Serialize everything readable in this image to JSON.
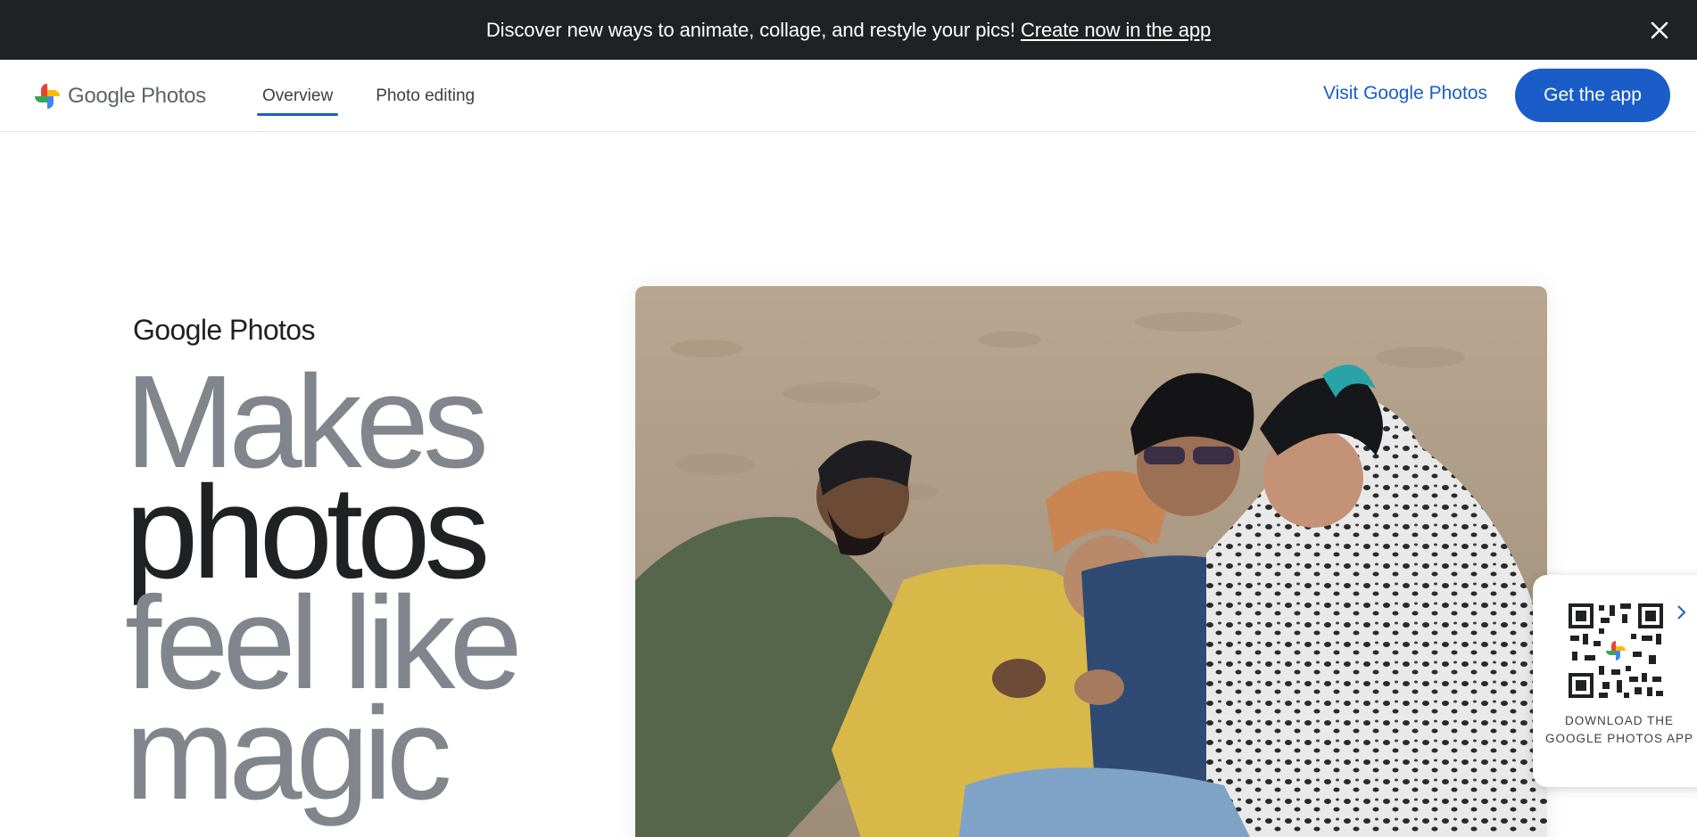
{
  "banner": {
    "message": "Discover new ways to animate, collage, and restyle your pics!",
    "link_label": "Create now in the app",
    "close_icon": "close-icon"
  },
  "header": {
    "logo_text": "Google Photos",
    "logo_icon": "google-photos-pinwheel-icon",
    "tabs": [
      {
        "label": "Overview",
        "active": true
      },
      {
        "label": "Photo editing",
        "active": false
      }
    ],
    "visit_label": "Visit Google Photos",
    "get_app_label": "Get the app"
  },
  "hero": {
    "brand": "Google Photos",
    "headline": [
      "Makes",
      "photos",
      "feel like",
      "magic"
    ],
    "photo_alt": "Four friends hugging on a sandy beach"
  },
  "qr_widget": {
    "caption": "DOWNLOAD THE GOOGLE PHOTOS APP",
    "icon": "qr-code-icon",
    "expand_icon": "chevron-right-icon"
  },
  "colors": {
    "banner_bg": "#202124",
    "accent": "#1a5dc9",
    "headline_grey": "#80868b",
    "headline_dark": "#202124"
  }
}
